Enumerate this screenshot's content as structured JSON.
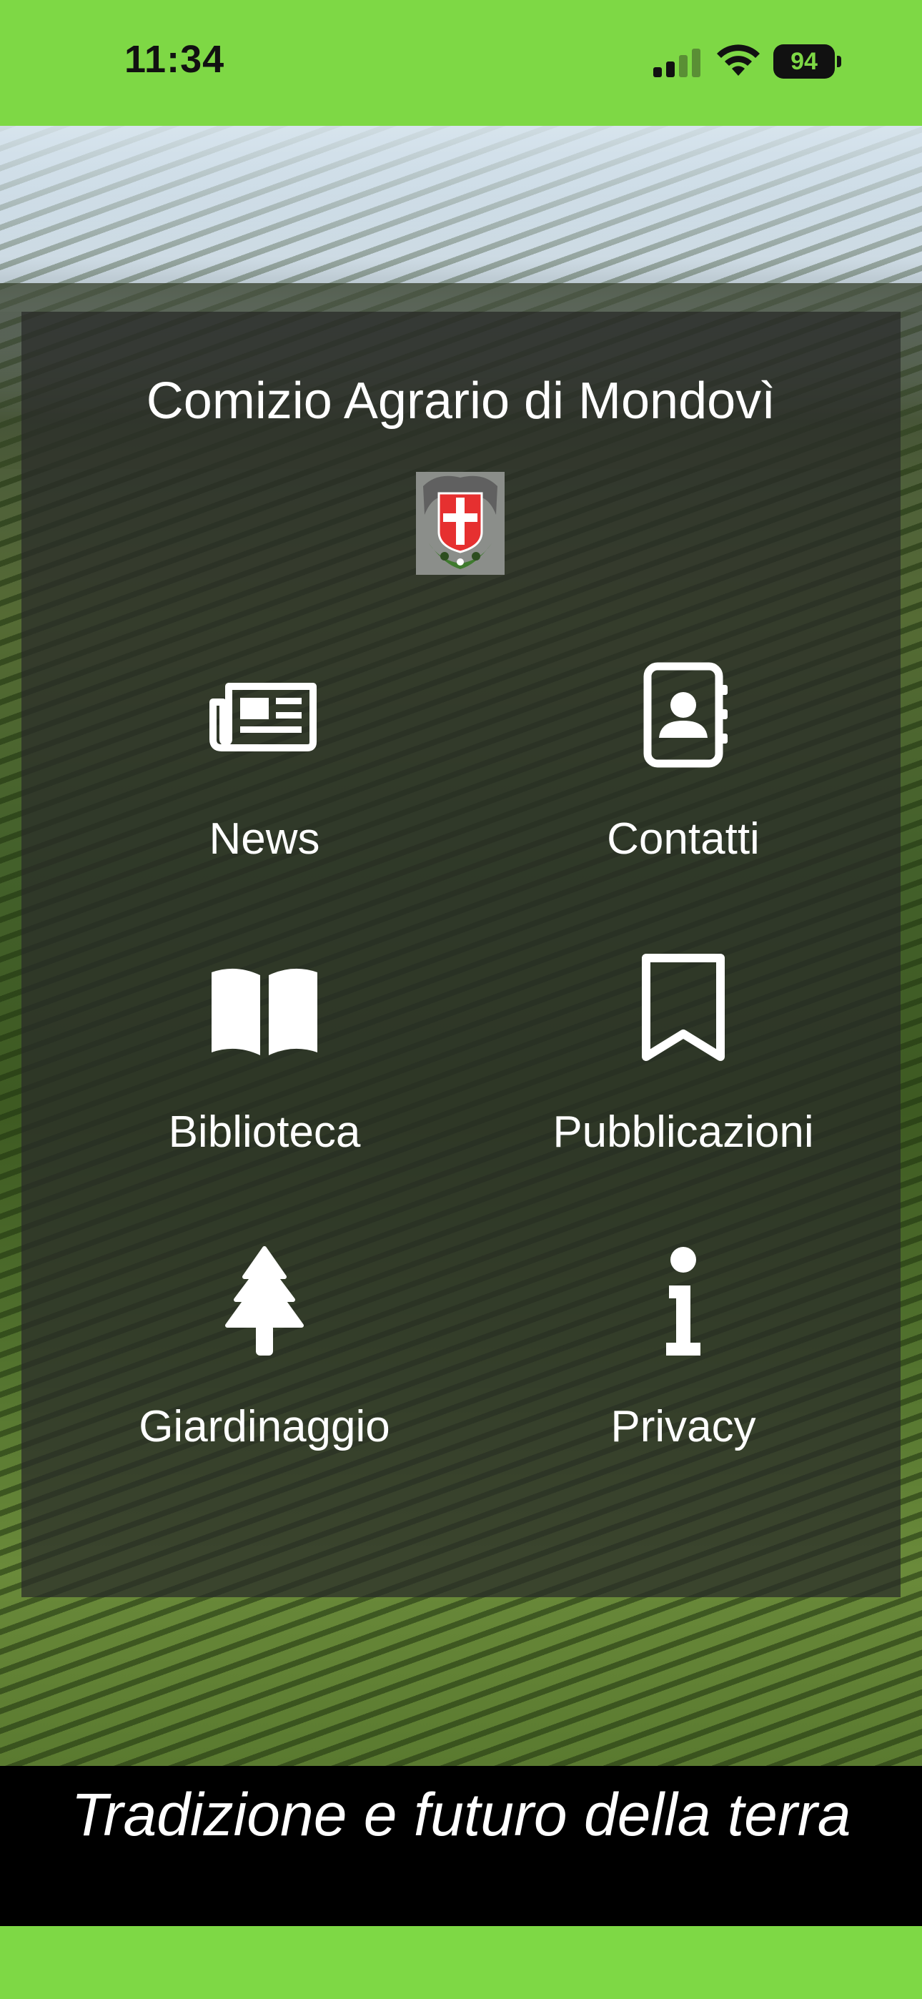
{
  "status_bar": {
    "time": "11:34",
    "battery": "94",
    "background_color": "#7ed845"
  },
  "header": {
    "title": "Comizio Agrario di Mondovì"
  },
  "menu": [
    {
      "label": "News",
      "icon": "newspaper-icon"
    },
    {
      "label": "Contatti",
      "icon": "address-book-icon"
    },
    {
      "label": "Biblioteca",
      "icon": "open-book-icon"
    },
    {
      "label": "Pubblicazioni",
      "icon": "bookmark-icon"
    },
    {
      "label": "Giardinaggio",
      "icon": "tree-icon"
    },
    {
      "label": "Privacy",
      "icon": "info-icon"
    }
  ],
  "footer": {
    "tagline": "Tradizione e futuro della terra"
  },
  "colors": {
    "accent_green": "#7ed845",
    "panel_overlay": "#282a28",
    "text": "#ffffff"
  }
}
